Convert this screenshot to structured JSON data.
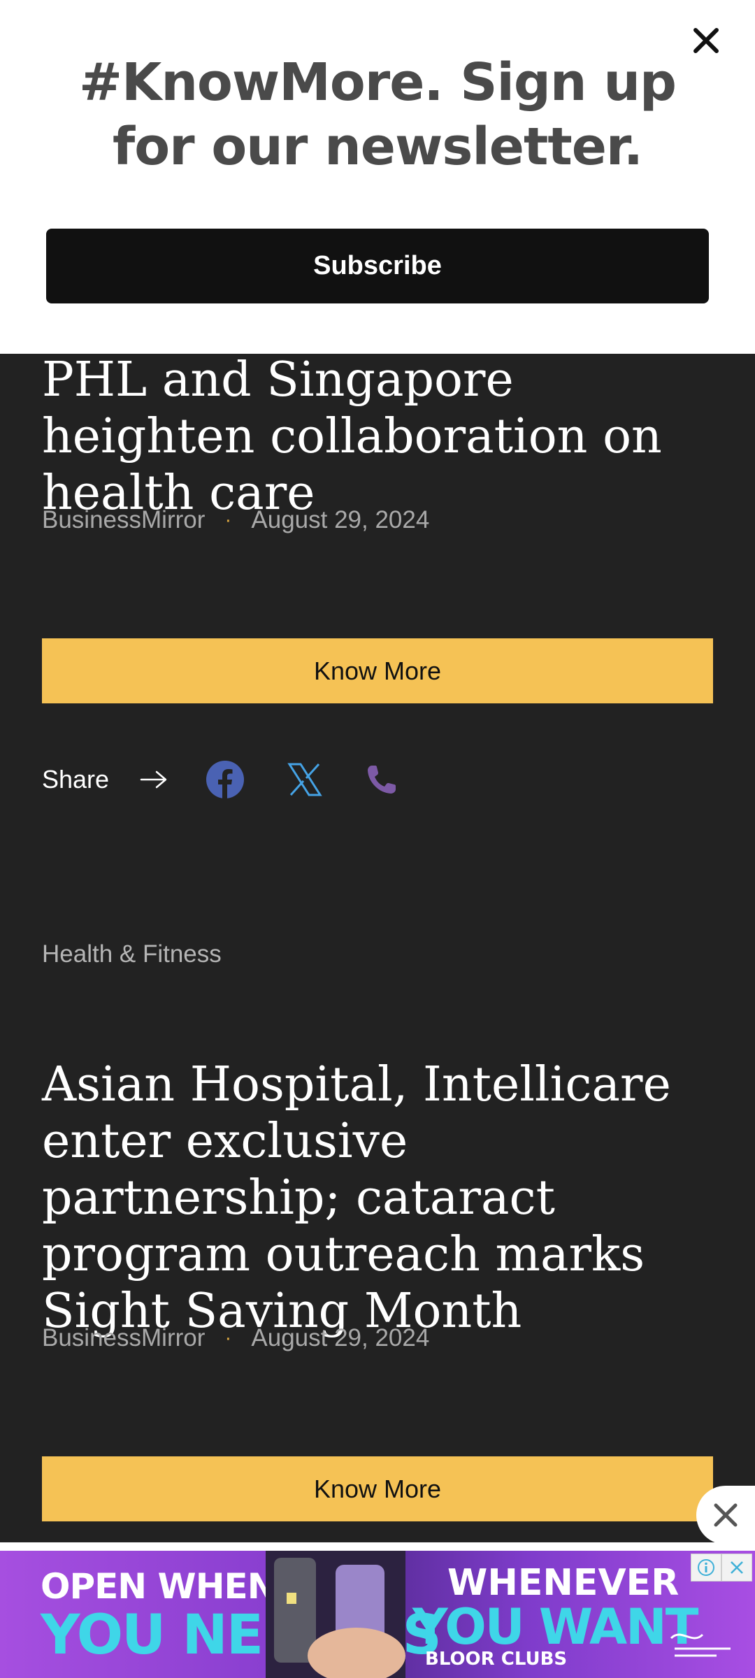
{
  "newsletter": {
    "title": "#KnowMore. Sign up for our newsletter.",
    "subscribe_label": "Subscribe",
    "close_icon": "close-icon"
  },
  "articles": [
    {
      "title": "PHL and Singapore heighten collaboration on health care",
      "source": "BusinessMirror",
      "separator": "·",
      "date": "August 29, 2024",
      "button_label": "Know More"
    },
    {
      "category": "Health & Fitness",
      "title": "Asian Hospital, Intellicare enter exclusive partnership; cataract program outreach marks Sight Saving Month",
      "source": "BusinessMirror",
      "separator": "·",
      "date": "August 29, 2024",
      "button_label": "Know More"
    }
  ],
  "share": {
    "label": "Share",
    "icons": [
      "arrow-right-icon",
      "facebook-icon",
      "x-icon",
      "phone-icon"
    ]
  },
  "colors": {
    "background": "#222222",
    "accent_button": "#f5c255",
    "facebook": "#4a62b3",
    "x": "#45a3e6",
    "phone": "#7d5aa6"
  },
  "ad": {
    "line1": "OPEN WHEN",
    "line2": "YOU NEED US",
    "line3": "WHENEVER",
    "line4": "YOU WANT",
    "line5": "BLOOR CLUBS",
    "icons": [
      "ad-info-icon",
      "ad-close-icon"
    ]
  },
  "floating_close_icon": "close-icon"
}
